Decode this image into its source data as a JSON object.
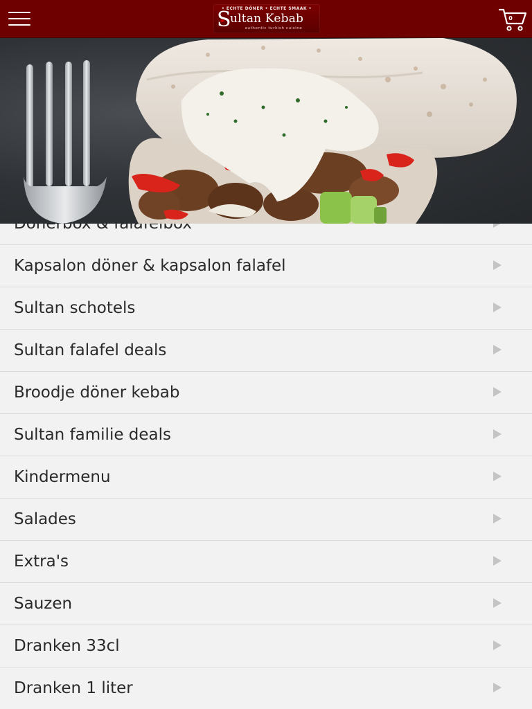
{
  "header": {
    "menu_icon": "hamburger-menu-icon",
    "logo": {
      "tagline": "• ECHTE DÖNER • ECHTE SMAAK •",
      "name": "ultan Kebab",
      "initial": "S",
      "subtitle": "authentic turkish cuisine"
    },
    "cart": {
      "icon": "shopping-cart-icon",
      "count": "0"
    }
  },
  "hero": {
    "image": "döner kebab in pita bread with garlic sauce and a fork on slate"
  },
  "categories": [
    {
      "label": "Dönerbox & falafelbox"
    },
    {
      "label": "Kapsalon döner & kapsalon falafel"
    },
    {
      "label": "Sultan schotels"
    },
    {
      "label": "Sultan falafel deals"
    },
    {
      "label": "Broodje döner kebab"
    },
    {
      "label": "Sultan familie deals"
    },
    {
      "label": "Kindermenu"
    },
    {
      "label": "Salades"
    },
    {
      "label": "Extra's"
    },
    {
      "label": "Sauzen"
    },
    {
      "label": "Dranken 33cl"
    },
    {
      "label": "Dranken 1 liter"
    }
  ],
  "colors": {
    "header_bg": "#6f0000",
    "list_bg": "#f2f2f2",
    "arrow": "#c4c4c4"
  }
}
